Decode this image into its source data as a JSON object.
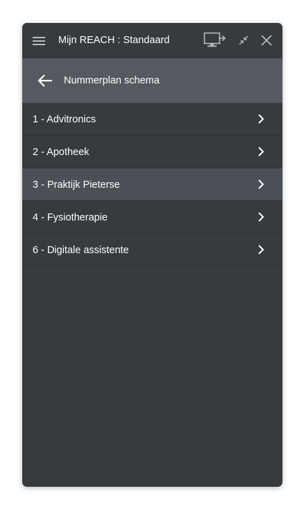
{
  "window": {
    "title": "Mijn REACH : Standaard",
    "icons": {
      "menu": "hamburger-menu-icon",
      "screen": "screen-share-icon",
      "minimize": "minimize-icon",
      "close": "close-icon"
    }
  },
  "subheader": {
    "title": "Nummerplan schema",
    "back_icon": "arrow-left-icon"
  },
  "list": {
    "items": [
      {
        "label": "1 - Advitronics",
        "selected": false
      },
      {
        "label": "2 - Apotheek",
        "selected": false
      },
      {
        "label": "3 - Praktijk Pieterse",
        "selected": true
      },
      {
        "label": "4 - Fysiotherapie",
        "selected": false
      },
      {
        "label": "6 - Digitale assistente",
        "selected": false
      }
    ],
    "chevron_icon": "chevron-right-icon"
  },
  "colors": {
    "background": "#363b3f",
    "subheader": "#545a5f",
    "selected_row": "#4a5055",
    "icon": "#b8bcbf",
    "text": "#ffffff"
  }
}
